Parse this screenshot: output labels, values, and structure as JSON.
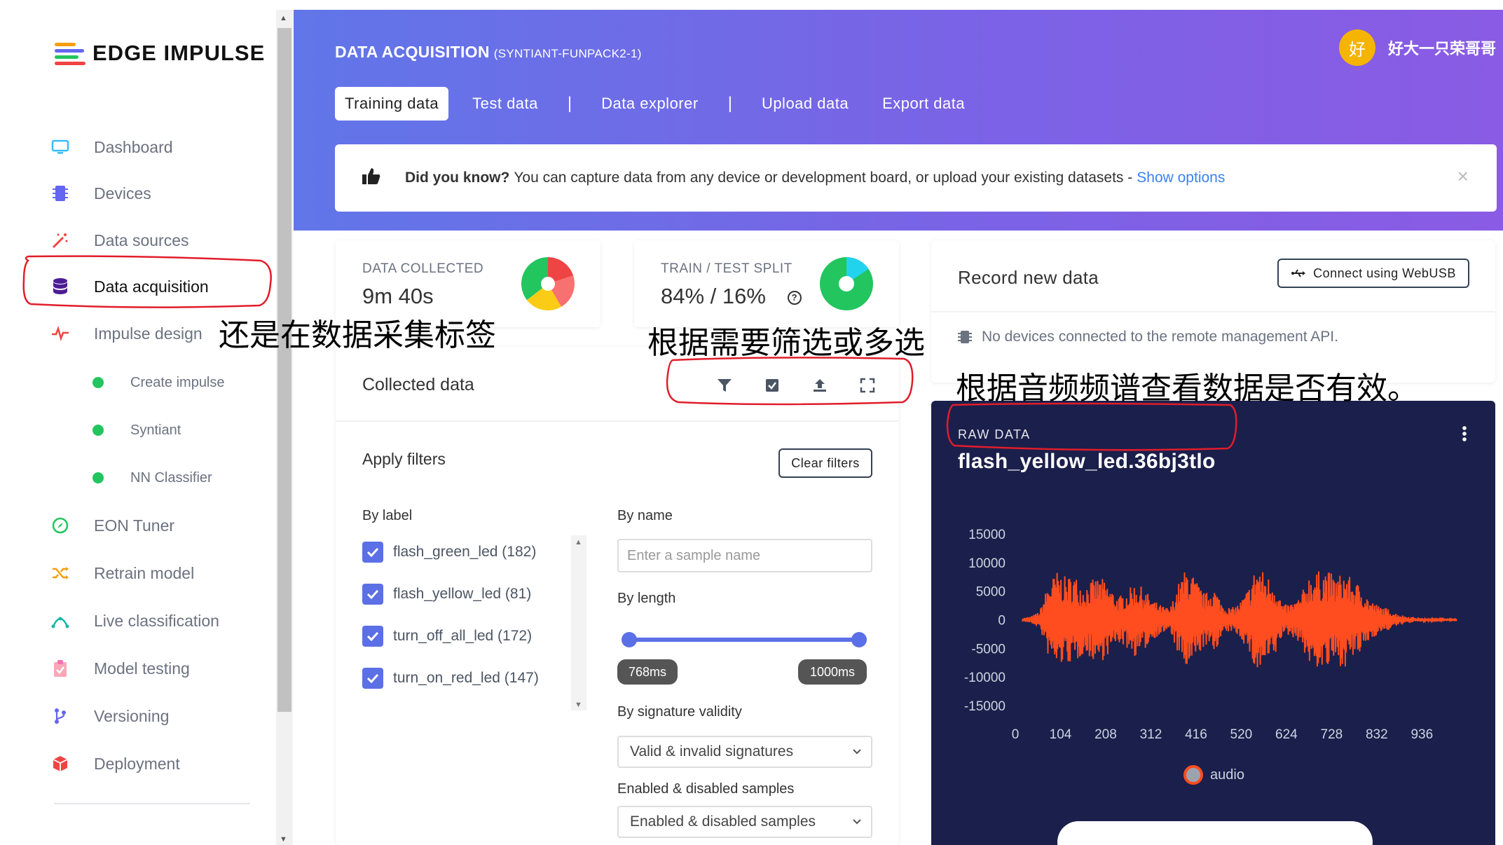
{
  "logo": {
    "text": "EDGE IMPULSE"
  },
  "sidebar": {
    "items": [
      {
        "label": "Dashboard",
        "icon": "monitor-icon"
      },
      {
        "label": "Devices",
        "icon": "chip-icon"
      },
      {
        "label": "Data sources",
        "icon": "magic-wand-icon"
      },
      {
        "label": "Data acquisition",
        "icon": "database-icon",
        "active": true
      },
      {
        "label": "Impulse design",
        "icon": "pulse-icon"
      },
      {
        "label": "EON Tuner",
        "icon": "compass-icon"
      },
      {
        "label": "Retrain model",
        "icon": "shuffle-icon"
      },
      {
        "label": "Live classification",
        "icon": "live-icon"
      },
      {
        "label": "Model testing",
        "icon": "clipboard-icon"
      },
      {
        "label": "Versioning",
        "icon": "branch-icon"
      },
      {
        "label": "Deployment",
        "icon": "box-icon"
      }
    ],
    "sub_items": [
      {
        "label": "Create impulse"
      },
      {
        "label": "Syntiant"
      },
      {
        "label": "NN Classifier"
      }
    ]
  },
  "header": {
    "title": "DATA ACQUISITION",
    "project": "(SYNTIANT-FUNPACK2-1)",
    "user_initial": "好",
    "user_name": "好大一只荣哥哥",
    "tabs": [
      {
        "label": "Training data",
        "active": true
      },
      {
        "label": "Test data"
      },
      {
        "label": "Data explorer"
      },
      {
        "label": "Upload data"
      },
      {
        "label": "Export data"
      }
    ],
    "tab_separator": "|",
    "notice": {
      "bold": "Did you know?",
      "text": "You can capture data from any device or development board, or upload your existing datasets -",
      "link": "Show options",
      "close": "×"
    }
  },
  "stats": {
    "collected_label": "DATA COLLECTED",
    "collected_value": "9m 40s",
    "split_label": "TRAIN / TEST SPLIT",
    "split_value": "84% / 16%",
    "help": "?"
  },
  "collected": {
    "title": "Collected data",
    "toolbar": [
      "filter-icon",
      "select-icon",
      "upload-icon",
      "expand-icon"
    ],
    "apply_filters": "Apply filters",
    "clear_filters": "Clear filters",
    "by_label": "By label",
    "labels": [
      "flash_green_led (182)",
      "flash_yellow_led (81)",
      "turn_off_all_led (172)",
      "turn_on_red_led (147)"
    ],
    "by_name": "By name",
    "name_placeholder": "Enter a sample name",
    "by_length": "By length",
    "length_min": "768ms",
    "length_max": "1000ms",
    "by_signature": "By signature validity",
    "signature_value": "Valid & invalid signatures",
    "enabled_label": "Enabled & disabled samples",
    "enabled_value": "Enabled & disabled samples"
  },
  "record": {
    "title": "Record new data",
    "connect": "Connect using WebUSB",
    "message": "No devices connected to the remote management API."
  },
  "raw": {
    "label": "RAW DATA",
    "name": "flash_yellow_led.36bj3tlo",
    "legend": "audio"
  },
  "chart_data": {
    "type": "line",
    "title": "",
    "xlabel": "",
    "ylabel": "",
    "yticks": [
      "15000",
      "10000",
      "5000",
      "0",
      "-5000",
      "-10000",
      "-15000"
    ],
    "xticks": [
      "0",
      "104",
      "208",
      "312",
      "416",
      "520",
      "624",
      "728",
      "832",
      "936"
    ],
    "ylim": [
      -15000,
      15000
    ],
    "xlim": [
      0,
      1000
    ],
    "series": [
      {
        "name": "audio",
        "color": "#ff4d1f",
        "envelope_x": [
          0,
          20,
          40,
          60,
          80,
          100,
          120,
          140,
          160,
          180,
          200,
          220,
          240,
          260,
          280,
          300,
          320,
          340,
          360,
          380,
          400,
          420,
          440,
          460,
          480,
          500,
          520,
          540,
          560,
          580,
          600,
          620,
          640,
          660,
          680,
          700,
          720,
          740,
          760,
          780,
          800,
          820,
          840,
          860,
          880,
          900,
          920,
          940,
          960,
          980
        ],
        "envelope_amp": [
          300,
          600,
          1500,
          6500,
          8500,
          7500,
          8000,
          6000,
          7000,
          7500,
          6000,
          4000,
          5000,
          6500,
          5500,
          3500,
          2500,
          2000,
          6500,
          9500,
          7000,
          4500,
          6000,
          3000,
          2000,
          3000,
          5500,
          10000,
          8000,
          7000,
          2500,
          3000,
          4000,
          8000,
          8500,
          9000,
          7500,
          8500,
          7000,
          6000,
          3500,
          2500,
          2000,
          1200,
          700,
          500,
          300,
          200,
          150,
          100
        ]
      }
    ]
  },
  "annotations": {
    "a1": "还是在数据采集标签",
    "a2": "根据需要筛选或多选",
    "a3": "根据音频频谱查看数据是否有效。"
  },
  "colors": {
    "accent": "#5b6fe6",
    "header_start": "#6176e8",
    "header_end": "#8a5be4",
    "raw_bg": "#1b1f4b",
    "waveform": "#ff4d1f",
    "annotation_red": "#e11d2a"
  }
}
